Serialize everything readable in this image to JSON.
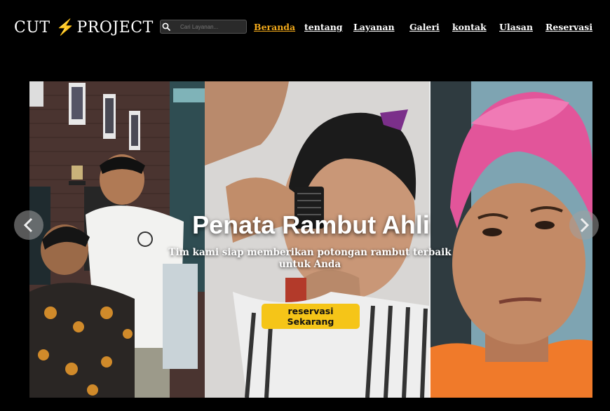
{
  "header": {
    "logo": {
      "left": "CUT",
      "bolt": "⚡",
      "right": "PROJECT"
    },
    "search": {
      "placeholder": "Cari Layanan..."
    },
    "nav": [
      {
        "label": "Beranda",
        "active": true
      },
      {
        "label": "tentang",
        "active": false
      },
      {
        "label": "Layanan",
        "active": false
      },
      {
        "label": "Galeri",
        "active": false
      },
      {
        "label": "kontak",
        "active": false
      },
      {
        "label": "Ulasan",
        "active": false
      },
      {
        "label": "Reservasi",
        "active": false
      }
    ]
  },
  "hero": {
    "title": "Penata Rambut Ahli",
    "subtitle": "Tim kami siap memberikan potongan rambut terbaik untuk Anda",
    "cta_label": "reservasi Sekarang",
    "images": [
      {
        "name": "barbershop-photo",
        "description_icon": "barber-cutting-hair"
      },
      {
        "name": "clipper-haircut-photo",
        "description_icon": "clipper"
      },
      {
        "name": "pink-hair-photo",
        "description_icon": "portrait"
      }
    ]
  },
  "colors": {
    "background": "#000000",
    "accent": "#f0a81a",
    "cta": "#f5c518"
  },
  "icons": {
    "search": "search-icon",
    "prev": "chevron-left-icon",
    "next": "chevron-right-icon",
    "bolt": "lightning-bolt-icon"
  }
}
